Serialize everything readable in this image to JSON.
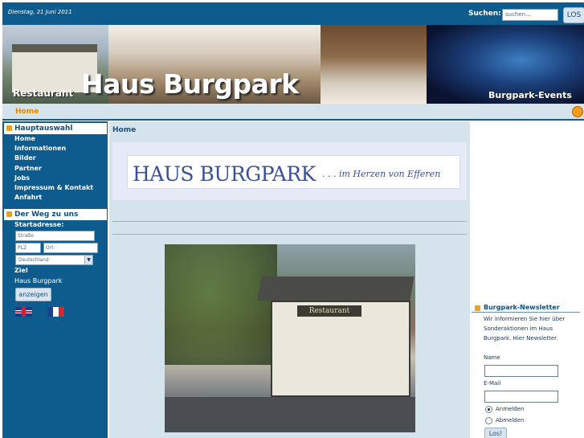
{
  "header": {
    "date": "Dienstag, 21 Juni 2011",
    "search_label": "Suchen:",
    "search_placeholder": "suchen...",
    "search_button": "LOS"
  },
  "banner": {
    "title": "Haus Burgpark",
    "left_caption": "Restaurant",
    "right_caption": "Burgpark-Events"
  },
  "navstrip": {
    "home": "Home",
    "icon": "rss-icon"
  },
  "sidebar": {
    "main_heading": "Hauptauswahl",
    "menu": [
      "Home",
      "Informationen",
      "Bilder",
      "Partner",
      "Jobs",
      "Impressum & Kontakt",
      "Anfahrt"
    ],
    "directions_heading": "Der Weg zu uns",
    "start_label": "Startadresse:",
    "street_placeholder": "Straße",
    "zip_placeholder": "PLZ",
    "city_placeholder": "Ort",
    "country_value": "Deutschland",
    "destination_label": "Ziel",
    "destination_value": "Haus Burgpark",
    "show_button": "anzeigen",
    "flags": [
      "uk-flag-icon",
      "france-flag-icon"
    ]
  },
  "main": {
    "page_title": "Home",
    "logo_text": "HAUS BURGPARK",
    "logo_tagline": ". . . im Herzen von Efferen",
    "photo_sign": "Restaurant"
  },
  "newsletter": {
    "heading": "Burgpark-Newsletter",
    "description": "Wir informieren Sie hier über Sonderaktionen im Haus Burgpark. Hier Newsletter.",
    "name_label": "Name",
    "email_label": "E-Mail",
    "subscribe_label": "Anmelden",
    "unsubscribe_label": "Abmelden",
    "submit_button": "Los!"
  },
  "colors": {
    "primary": "#0e5c8e",
    "panel": "#d4e3ec",
    "accent": "#e8a22a"
  }
}
